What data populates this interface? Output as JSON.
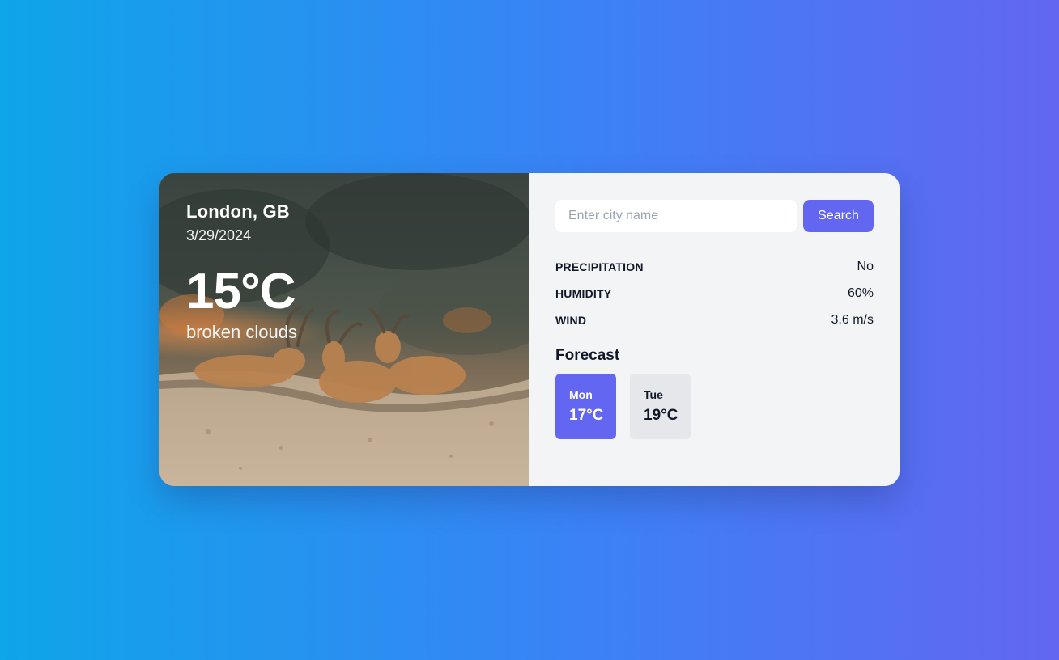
{
  "weather": {
    "city": "London, GB",
    "date": "3/29/2024",
    "temperature": "15°C",
    "description": "broken clouds"
  },
  "search": {
    "placeholder": "Enter city name",
    "value": "",
    "button_label": "Search"
  },
  "stats": [
    {
      "label": "PRECIPITATION",
      "value": "No"
    },
    {
      "label": "HUMIDITY",
      "value": "60%"
    },
    {
      "label": "WIND",
      "value": "3.6 m/s"
    }
  ],
  "forecast": {
    "title": "Forecast",
    "days": [
      {
        "day": "Mon",
        "temp": "17°C",
        "active": true
      },
      {
        "day": "Tue",
        "temp": "19°C",
        "active": false
      }
    ]
  },
  "colors": {
    "accent": "#6366f1",
    "panel_bg": "#f3f4f6",
    "inactive_tile": "#e5e7eb",
    "gradient_start": "#0ea5e9",
    "gradient_end": "#6366f1"
  }
}
